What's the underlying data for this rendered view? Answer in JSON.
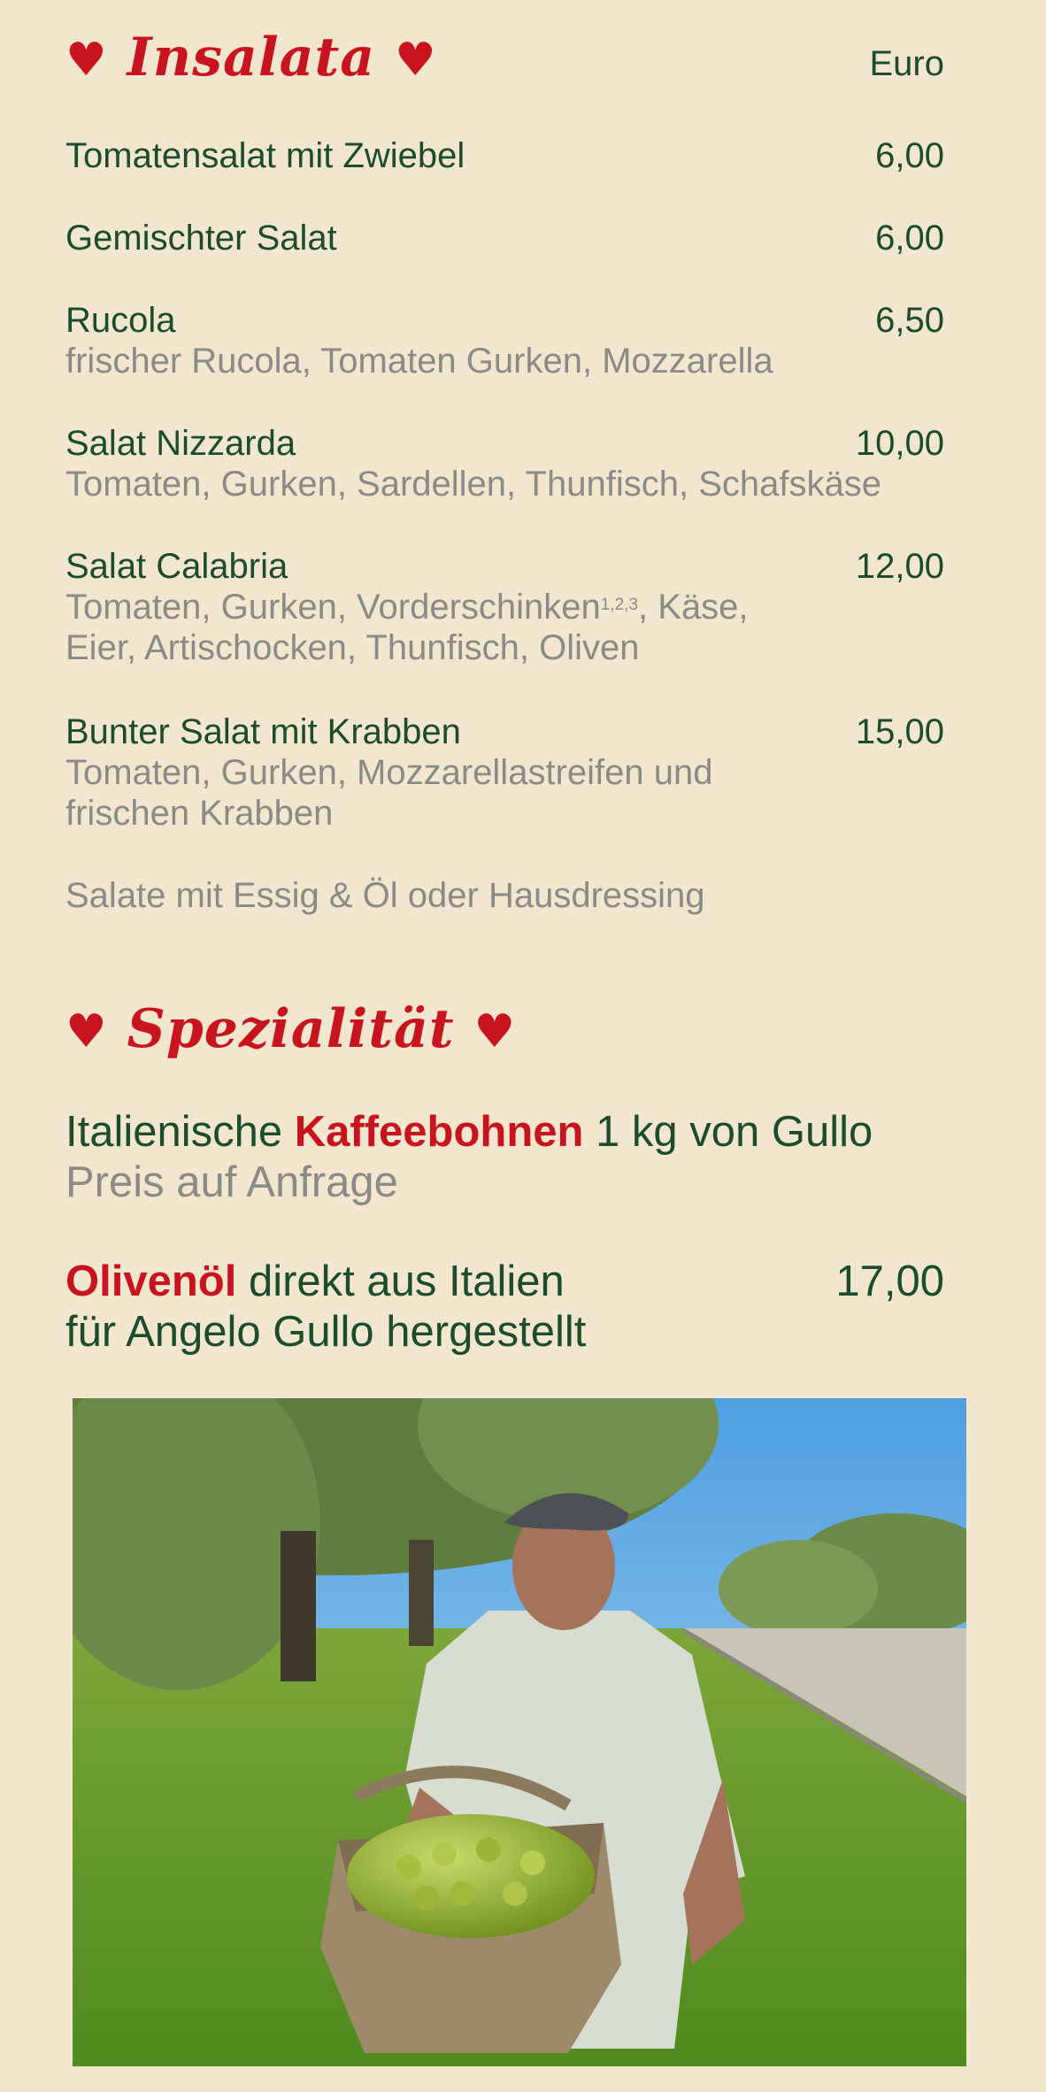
{
  "insalata": {
    "title": "Insalata",
    "heart": "♥",
    "currency": "Euro",
    "items": [
      {
        "name": "Tomatensalat mit Zwiebel",
        "price": "6,00"
      },
      {
        "name": "Gemischter Salat",
        "price": "6,00"
      },
      {
        "name": "Rucola",
        "price": "6,50",
        "desc": "frischer Rucola, Tomaten Gurken, Mozzarella"
      },
      {
        "name": "Salat Nizzarda",
        "price": "10,00",
        "desc": "Tomaten, Gurken, Sardellen, Thunfisch, Schafskäse"
      },
      {
        "name": "Salat Calabria",
        "price": "12,00",
        "desc_a": "Tomaten, Gurken, Vorderschinken",
        "desc_sup": "1,2,3",
        "desc_b": ", Käse,",
        "desc_2": "Eier, Artischocken, Thunfisch, Oliven"
      },
      {
        "name": "Bunter Salat mit Krabben",
        "price": "15,00",
        "desc": "Tomaten, Gurken, Mozzarellastreifen und",
        "desc_2": "frischen Krabben"
      }
    ],
    "note": "Salate mit Essig & Öl oder Hausdressing"
  },
  "spezialitaet": {
    "title": "Spezialität",
    "coffee": {
      "pre": "Italienische ",
      "highlight": "Kaffeebohnen",
      "post": " 1 kg von Gullo",
      "sub": "Preis auf Anfrage"
    },
    "oil": {
      "highlight": "Olivenöl",
      "post": " direkt aus Italien",
      "price": "17,00",
      "sub": "für Angelo Gullo hergestellt"
    }
  },
  "colors": {
    "background": "#f2e6ce",
    "accent": "#c8141e",
    "text": "#1b4d2c",
    "muted": "#8a8a86"
  }
}
